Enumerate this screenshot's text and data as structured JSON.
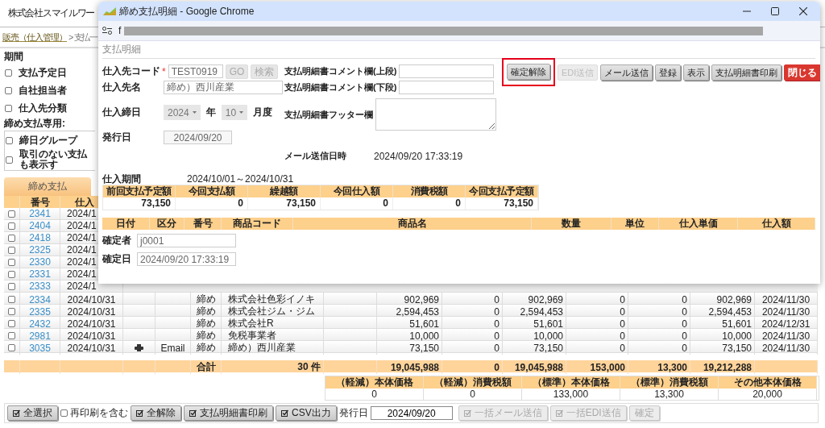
{
  "app": {
    "title": "株式会社スマイルワー",
    "breadcrumb": [
      {
        "kind": "link",
        "label": "販売（仕入管理）"
      },
      {
        "kind": "text",
        "label": "> 支払一"
      }
    ]
  },
  "filters": {
    "period_label": "期間",
    "period_options": [
      {
        "label": "支払予定日",
        "checked": false
      },
      {
        "label": "自社担当者",
        "checked": false
      },
      {
        "label": "仕入先分類",
        "checked": false
      }
    ],
    "closing_label": "締め支払専用:",
    "closing_options": [
      {
        "label": "締日グループ",
        "checked": false
      },
      {
        "label": "取引のない支払も表示す",
        "checked": false
      }
    ]
  },
  "tabs": [
    {
      "label": "締め支払",
      "selected": true
    }
  ],
  "payments": {
    "columns": [
      "番号",
      "仕入"
    ],
    "rows": [
      {
        "checked": false,
        "number": "2341",
        "date": "2024/1"
      },
      {
        "checked": false,
        "number": "2404",
        "date": "2024/1"
      },
      {
        "checked": false,
        "number": "2418",
        "date": "2024/1"
      },
      {
        "checked": false,
        "number": "2325",
        "date": "2024/1"
      },
      {
        "checked": false,
        "number": "2330",
        "date": "2024/1"
      },
      {
        "checked": false,
        "number": "2331",
        "date": "2024/1"
      },
      {
        "checked": false,
        "number": "2333",
        "date": "2024/1"
      },
      {
        "checked": false,
        "number": "2334",
        "date": "2024/10/31",
        "printed": false,
        "category": "締め",
        "supplier": "株式会社色彩イノキ",
        "amounts": [
          "902,969",
          "0",
          "902,969",
          "0",
          "0",
          "902,969"
        ],
        "due": "2024/11/30"
      },
      {
        "checked": false,
        "number": "2335",
        "date": "2024/10/31",
        "printed": false,
        "category": "締め",
        "supplier": "株式会社ジム・ジム",
        "amounts": [
          "2,594,453",
          "0",
          "2,594,453",
          "0",
          "0",
          "2,594,453"
        ],
        "due": "2024/11/30"
      },
      {
        "checked": false,
        "number": "2432",
        "date": "2024/10/31",
        "printed": false,
        "category": "締め",
        "supplier": "株式会社R",
        "amounts": [
          "51,601",
          "0",
          "51,601",
          "0",
          "0",
          "51,601"
        ],
        "due": "2024/12/31"
      },
      {
        "checked": false,
        "number": "2981",
        "date": "2024/10/31",
        "printed": false,
        "category": "締め",
        "supplier": "免税事業者",
        "amounts": [
          "10,000",
          "0",
          "10,000",
          "0",
          "0",
          "10,000"
        ],
        "due": "2024/11/30"
      },
      {
        "checked": false,
        "number": "3035",
        "date": "2024/10/31",
        "printed": true,
        "method": "Email",
        "category": "締め",
        "supplier": "締め）西川産業",
        "amounts": [
          "73,150",
          "0",
          "73,150",
          "0",
          "0",
          "73,150"
        ],
        "due": "2024/11/30"
      }
    ],
    "total": {
      "label": "合計",
      "count": "30 件",
      "amounts": [
        "19,045,988",
        "0",
        "19,045,988",
        "153,000",
        "13,300",
        "19,212,288"
      ]
    }
  },
  "tax_summary": {
    "columns": [
      "（軽減）本体価格",
      "（軽減）消費税額",
      "（標準）本体価格",
      "（標準）消費税額",
      "その他本体価格"
    ],
    "values": [
      "0",
      "0",
      "133,000",
      "13,300",
      "20,000"
    ]
  },
  "toolbar": [
    {
      "kind": "icon-button",
      "label": "全選択",
      "disabled": false
    },
    {
      "kind": "checkbox",
      "label": "再印刷を含む",
      "checked": false
    },
    {
      "kind": "icon-button",
      "label": "全解除",
      "disabled": false
    },
    {
      "kind": "icon-button",
      "label": "支払明細書印刷",
      "disabled": false
    },
    {
      "kind": "icon-button",
      "label": "CSV出力",
      "disabled": false
    },
    {
      "kind": "label",
      "label": "発行日"
    },
    {
      "kind": "field",
      "value": "2024/09/20"
    },
    {
      "kind": "icon-button",
      "label": "一括メール送信",
      "disabled": true
    },
    {
      "kind": "icon-button",
      "label": "一括EDI送信",
      "disabled": true
    },
    {
      "kind": "button",
      "label": "確定",
      "disabled": true
    }
  ],
  "popup": {
    "title": "締め支払明細 - Google Chrome",
    "address": "f",
    "section": "支払明細",
    "supplier_code": {
      "label": "仕入先コード",
      "required": true,
      "required_mark": "*",
      "value": "TEST0919",
      "buttons": [
        {
          "label": "GO",
          "disabled": true
        },
        {
          "label": "検索",
          "disabled": true
        }
      ]
    },
    "supplier_name": {
      "label": "仕入先名",
      "value": "締め）西川産業"
    },
    "closing": {
      "label": "仕入締日",
      "year": "2024",
      "year_unit": "年",
      "month": "10",
      "month_unit": "月度"
    },
    "issue_date": {
      "label": "発行日",
      "value": "2024/09/20"
    },
    "comments": [
      {
        "kind": "input",
        "label": "支払明細書コメント欄(上段)"
      },
      {
        "kind": "input",
        "label": "支払明細書コメント欄(下段)"
      },
      {
        "kind": "textarea",
        "label": "支払明細書フッター欄"
      }
    ],
    "mail_sent": {
      "label": "メール送信日時",
      "value": "2024/09/20 17:33:19"
    },
    "actions": [
      {
        "kind": "default",
        "label": "確定解除",
        "disabled": false,
        "highlighted": true
      },
      {
        "kind": "default",
        "label": "EDI送信",
        "disabled": true,
        "highlighted": false
      },
      {
        "kind": "default",
        "label": "メール送信",
        "disabled": false,
        "highlighted": false
      },
      {
        "kind": "default",
        "label": "登録",
        "disabled": false,
        "highlighted": false
      },
      {
        "kind": "default",
        "label": "表示",
        "disabled": false,
        "highlighted": false
      },
      {
        "kind": "default",
        "label": "支払明細書印刷",
        "disabled": false,
        "highlighted": false
      },
      {
        "kind": "danger",
        "label": "閉じる",
        "disabled": false,
        "highlighted": false
      }
    ],
    "period": {
      "label": "仕入期間",
      "value": "2024/10/01～2024/10/31"
    },
    "summary": {
      "columns": [
        "前回支払予定額",
        "今回支払額",
        "繰越額",
        "今回仕入額",
        "消費税額",
        "今回支払予定額"
      ],
      "values": [
        "73,150",
        "0",
        "73,150",
        "0",
        "0",
        "73,150"
      ]
    },
    "detail_columns": [
      "日付",
      "区分",
      "番号",
      "商品コード",
      "商品名",
      "数量",
      "単位",
      "仕入単価",
      "仕入額"
    ],
    "confirmer": {
      "label": "確定者",
      "value": "j0001"
    },
    "confirmed_date": {
      "label": "確定日",
      "value": "2024/09/20 17:33:19"
    }
  }
}
